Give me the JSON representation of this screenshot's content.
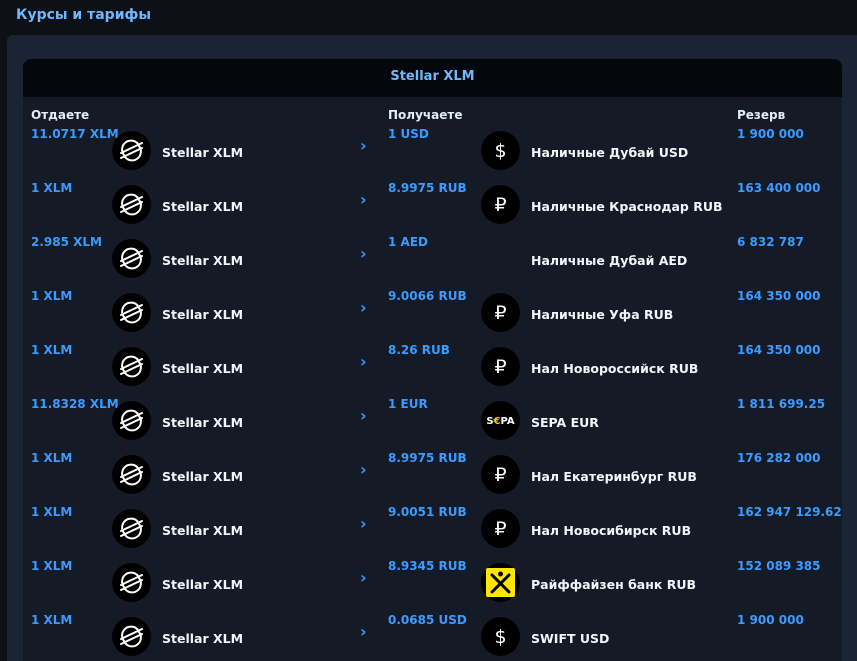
{
  "header": {
    "title": "Курсы и тарифы"
  },
  "card": {
    "title": "Stellar XLM"
  },
  "columns": {
    "give": "Отдаете",
    "get": "Получаете",
    "reserve": "Резерв"
  },
  "arrow_glyph": "›",
  "rows": [
    {
      "give_amount": "11.0717 XLM",
      "give_name": "Stellar XLM",
      "give_icon": "stellar-icon",
      "get_amount": "1 USD",
      "get_name": "Наличные Дубай USD",
      "get_icon": "dollar-icon",
      "reserve": "1 900 000"
    },
    {
      "give_amount": "1 XLM",
      "give_name": "Stellar XLM",
      "give_icon": "stellar-icon",
      "get_amount": "8.9975 RUB",
      "get_name": "Наличные Краснодар RUB",
      "get_icon": "ruble-icon",
      "reserve": "163 400 000"
    },
    {
      "give_amount": "2.985 XLM",
      "give_name": "Stellar XLM",
      "give_icon": "stellar-icon",
      "get_amount": "1 AED",
      "get_name": "Наличные Дубай AED",
      "get_icon": "none",
      "reserve": "6 832 787"
    },
    {
      "give_amount": "1 XLM",
      "give_name": "Stellar XLM",
      "give_icon": "stellar-icon",
      "get_amount": "9.0066 RUB",
      "get_name": "Наличные Уфа RUB",
      "get_icon": "ruble-icon",
      "reserve": "164 350 000"
    },
    {
      "give_amount": "1 XLM",
      "give_name": "Stellar XLM",
      "give_icon": "stellar-icon",
      "get_amount": "8.26 RUB",
      "get_name": "Нал Новороссийск RUB",
      "get_icon": "ruble-icon",
      "reserve": "164 350 000"
    },
    {
      "give_amount": "11.8328 XLM",
      "give_name": "Stellar XLM",
      "give_icon": "stellar-icon",
      "get_amount": "1 EUR",
      "get_name": "SEPA EUR",
      "get_icon": "sepa-icon",
      "reserve": "1 811 699.25"
    },
    {
      "give_amount": "1 XLM",
      "give_name": "Stellar XLM",
      "give_icon": "stellar-icon",
      "get_amount": "8.9975 RUB",
      "get_name": "Нал Екатеринбург RUB",
      "get_icon": "ruble-icon",
      "reserve": "176 282 000"
    },
    {
      "give_amount": "1 XLM",
      "give_name": "Stellar XLM",
      "give_icon": "stellar-icon",
      "get_amount": "9.0051 RUB",
      "get_name": "Нал Новосибирск RUB",
      "get_icon": "ruble-icon",
      "reserve": "162 947 129.62"
    },
    {
      "give_amount": "1 XLM",
      "give_name": "Stellar XLM",
      "give_icon": "stellar-icon",
      "get_amount": "8.9345 RUB",
      "get_name": "Райффайзен банк RUB",
      "get_icon": "raiffeisen-icon",
      "reserve": "152 089 385"
    },
    {
      "give_amount": "1 XLM",
      "give_name": "Stellar XLM",
      "give_icon": "stellar-icon",
      "get_amount": "0.0685 USD",
      "get_name": "SWIFT USD",
      "get_icon": "dollar-icon",
      "reserve": "1 900 000"
    }
  ],
  "colors": {
    "accent": "#3b9bff",
    "title": "#6fb7ff",
    "raiffeisen_yellow": "#ffe600"
  }
}
